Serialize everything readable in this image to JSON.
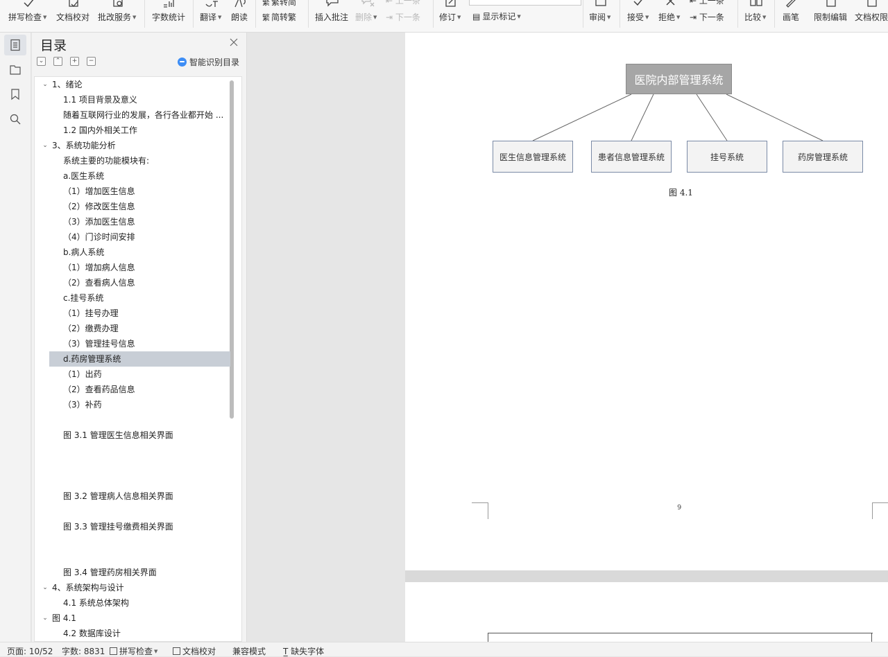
{
  "ribbon": {
    "spell_check": "拼写检查",
    "doc_proof": "文档校对",
    "batch_service": "批改服务",
    "word_count": "字数统计",
    "translate": "翻译",
    "read_aloud": "朗读",
    "simp_trad": "简转繁",
    "trad_simp": "繁转简",
    "insert_comment": "插入批注",
    "delete": "删除",
    "prev_item": "上一条",
    "next_item_disabled": "下一条",
    "track_changes": "修订",
    "show_markup": "显示标记",
    "review": "审阅",
    "accept": "接受",
    "reject": "拒绝",
    "next_item": "下一条",
    "prev_item_right": "上一条",
    "compare": "比较",
    "pen": "画笔",
    "restrict_edit": "限制编辑",
    "doc_permission": "文档权限"
  },
  "toc": {
    "title": "目录",
    "smart_recognize": "智能识别目录",
    "items": [
      {
        "text": "1、绪论",
        "level": 1,
        "expand": true
      },
      {
        "text": "1.1 项目背景及意义",
        "level": 2
      },
      {
        "text": "随着互联网行业的发展，各行各业都开始 ...",
        "level": 2
      },
      {
        "text": "1.2 国内外相关工作",
        "level": 2
      },
      {
        "text": "3、系统功能分析",
        "level": 1,
        "expand": true
      },
      {
        "text": "系统主要的功能模块有:",
        "level": 2
      },
      {
        "text": "a.医生系统",
        "level": 2
      },
      {
        "text": "（1）增加医生信息",
        "level": 3
      },
      {
        "text": "（2）修改医生信息",
        "level": 3
      },
      {
        "text": "（3）添加医生信息",
        "level": 3
      },
      {
        "text": "（4）门诊时间安排",
        "level": 3
      },
      {
        "text": "b.病人系统",
        "level": 2
      },
      {
        "text": "（1）增加病人信息",
        "level": 3
      },
      {
        "text": "（2）查看病人信息",
        "level": 3
      },
      {
        "text": "c.挂号系统",
        "level": 2
      },
      {
        "text": "（1）挂号办理",
        "level": 3
      },
      {
        "text": "（2）缴费办理",
        "level": 3
      },
      {
        "text": "（3）管理挂号信息",
        "level": 3
      },
      {
        "text": "d.药房管理系统",
        "level": 2,
        "selected": true
      },
      {
        "text": "（1）出药",
        "level": 3
      },
      {
        "text": "（2）查看药品信息",
        "level": 3
      },
      {
        "text": "（3）补药",
        "level": 3
      },
      {
        "text": "图 3.1  管理医生信息相关界面",
        "level": 2
      },
      {
        "text": "图 3.2  管理病人信息相关界面",
        "level": 2
      },
      {
        "text": "图 3.3  管理挂号缴费相关界面",
        "level": 2
      },
      {
        "text": "图 3.4  管理药房相关界面",
        "level": 2
      },
      {
        "text": "4、系统架构与设计",
        "level": 1,
        "expand": true
      },
      {
        "text": "4.1 系统总体架构",
        "level": 2
      },
      {
        "text": "图 4.1",
        "level": 1,
        "expand": true
      },
      {
        "text": "4.2 数据库设计",
        "level": 2
      }
    ]
  },
  "document": {
    "root_box": "医院内部管理系统",
    "children": [
      "医生信息管理系统",
      "患者信息管理系统",
      "挂号系统",
      "药房管理系统"
    ],
    "figure_caption": "图 4.1",
    "page_number": "9"
  },
  "status": {
    "page": "页面: 10/52",
    "words": "字数: 8831",
    "spell_check": "拼写检查",
    "doc_proof": "文档校对",
    "compat_mode": "兼容模式",
    "missing_font": "缺失字体"
  },
  "colors": {
    "root_fill": "#a6a6a6",
    "child_border": "#7a8aa6",
    "selection": "#c8ced6",
    "smart_icon": "#3d8df5"
  }
}
